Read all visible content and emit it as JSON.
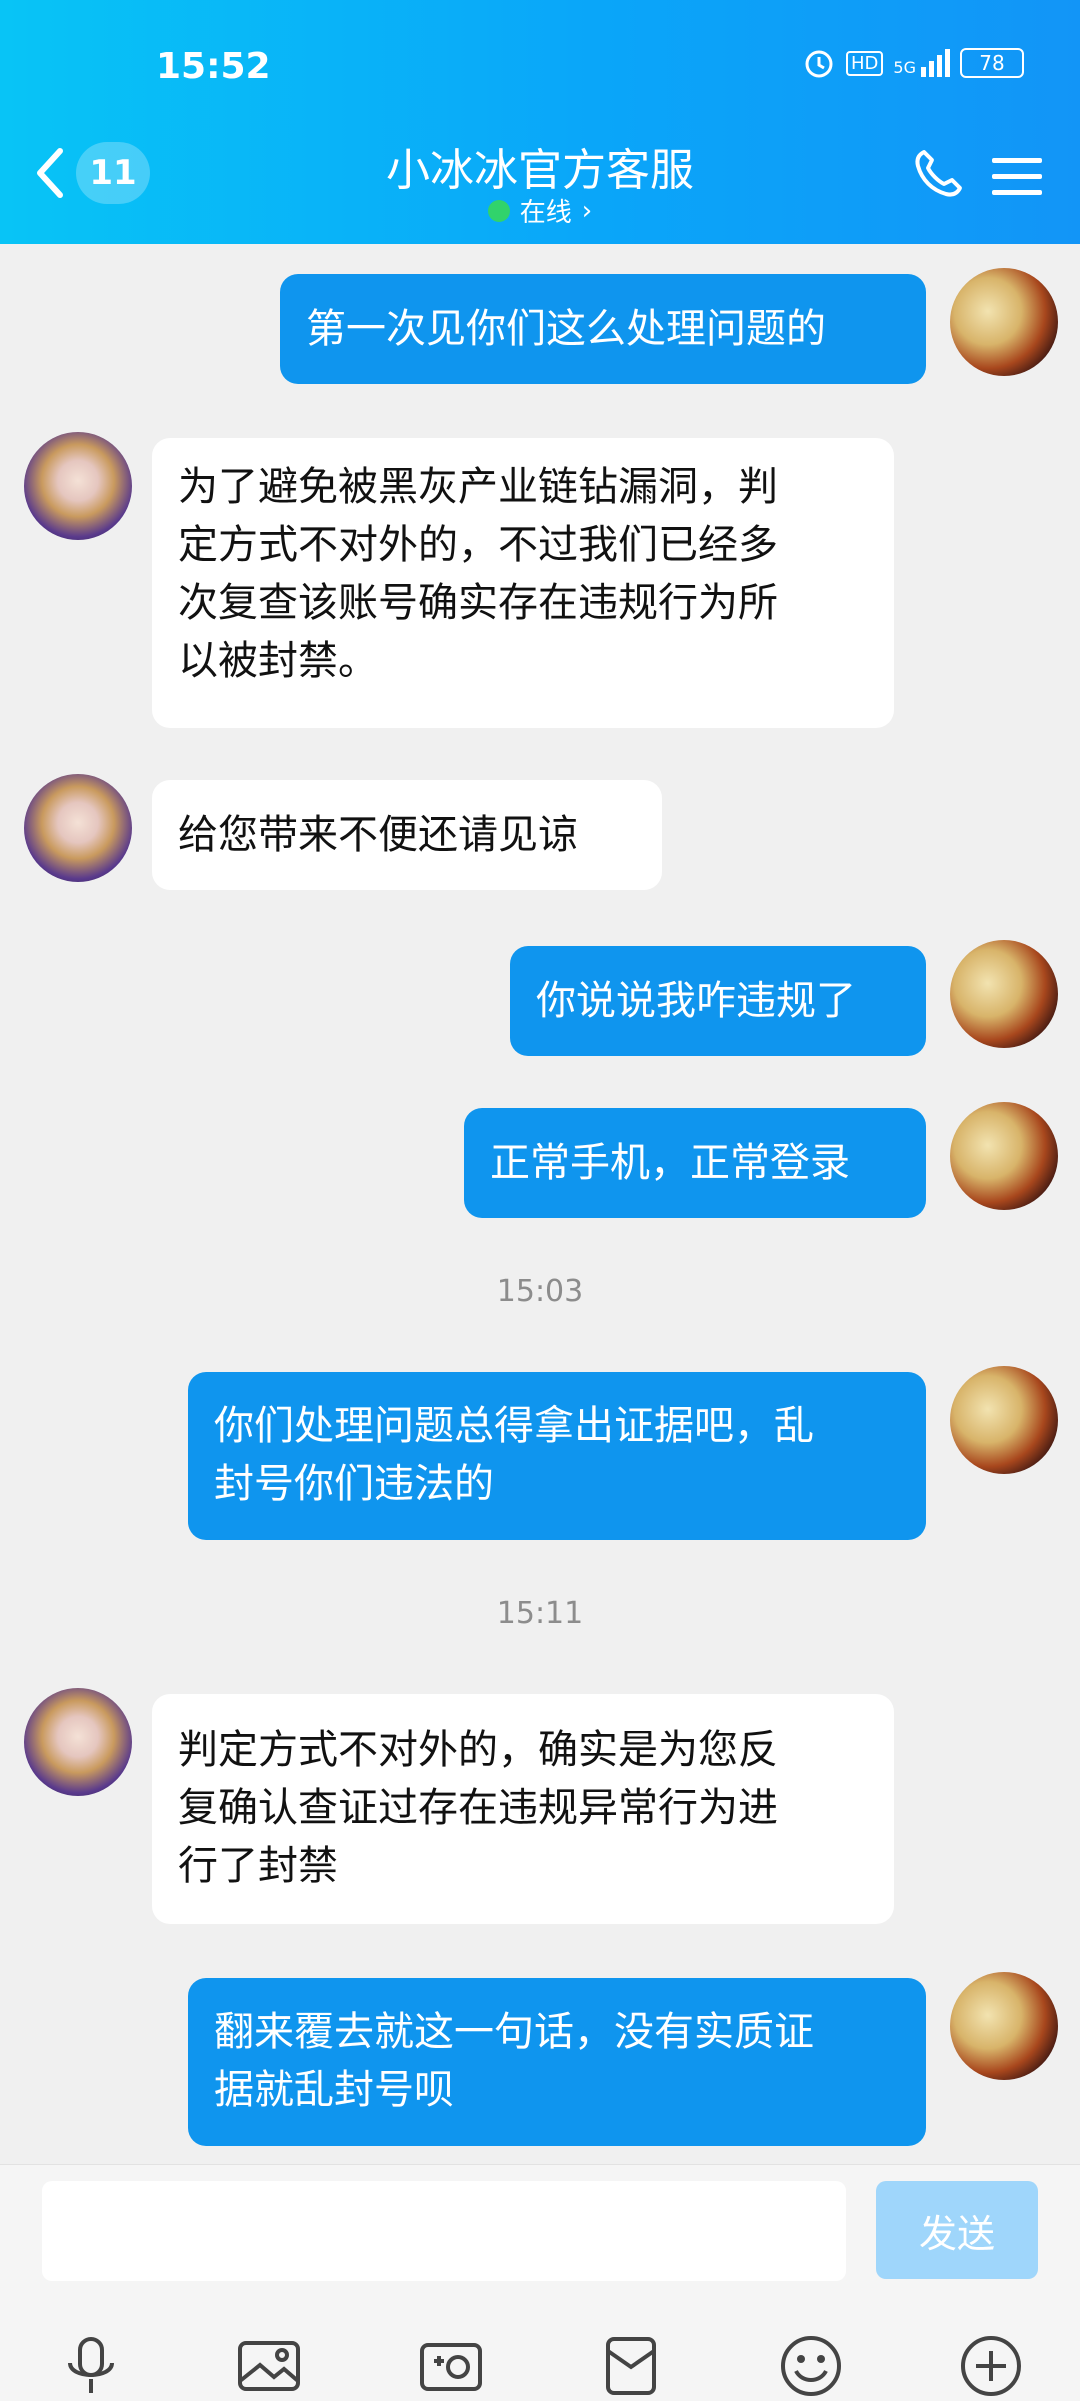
{
  "status_bar": {
    "time": "15:52",
    "battery": "78",
    "hd": "HD",
    "network": "5G"
  },
  "header": {
    "unread_count": "11",
    "title": "小冰冰官方客服",
    "online_text": "在线",
    "online_chevron": "›"
  },
  "messages": [
    {
      "sender": "me",
      "text": "第一次见你们这么处理问题的"
    },
    {
      "sender": "them",
      "lines": [
        "为了避免被黑灰产业链钻漏洞，判",
        "定方式不对外的，不过我们已经多",
        "次复查该账号确实存在违规行为所",
        "以被封禁。"
      ]
    },
    {
      "sender": "them",
      "text": "给您带来不便还请见谅"
    },
    {
      "sender": "me",
      "text": "你说说我咋违规了"
    },
    {
      "sender": "me",
      "text": "正常手机，正常登录"
    },
    {
      "sender": "me",
      "lines": [
        "你们处理问题总得拿出证据吧，乱",
        "封号你们违法的"
      ]
    },
    {
      "sender": "them",
      "lines": [
        "判定方式不对外的，确实是为您反",
        "复确认查证过存在违规异常行为进",
        "行了封禁"
      ]
    },
    {
      "sender": "me",
      "lines": [
        "翻来覆去就这一句话，没有实质证",
        "据就乱封号呗"
      ]
    }
  ],
  "timestamps": [
    "15:03",
    "15:11"
  ],
  "input": {
    "placeholder": "",
    "send_label": "发送"
  },
  "toolbar": [
    "mic-icon",
    "image-icon",
    "camera-icon",
    "red-packet-icon",
    "emoji-icon",
    "plus-icon"
  ],
  "colors": {
    "header_start": "#08c4f6",
    "header_end": "#1295f7",
    "my_bubble": "#0f95ee",
    "send_button": "#9fd6fb",
    "online_dot": "#31d36b"
  }
}
